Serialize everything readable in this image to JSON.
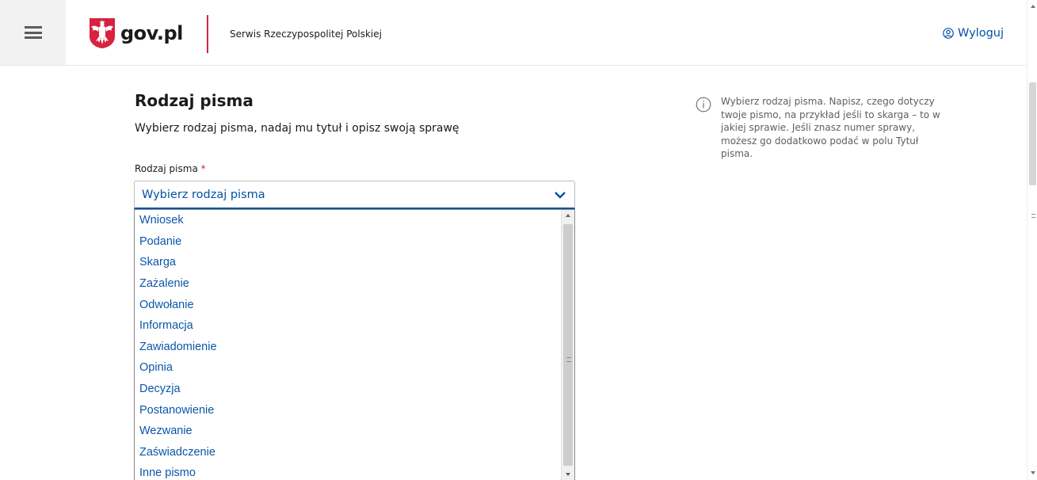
{
  "header": {
    "menu_icon": "hamburger-icon",
    "logo_emblem": "polish-eagle-emblem",
    "logo_text": "gov.pl",
    "service_name": "Serwis Rzeczypospolitej Polskiej",
    "logout_icon": "user-circle-icon",
    "logout_label": "Wyloguj"
  },
  "form": {
    "title": "Rodzaj pisma",
    "subtitle": "Wybierz rodzaj pisma, nadaj mu tytuł i opisz swoją sprawę",
    "field_label": "Rodzaj pisma",
    "required_mark": "*",
    "select_value": "Wybierz rodzaj pisma",
    "options": [
      "Wniosek",
      "Podanie",
      "Skarga",
      "Zażalenie",
      "Odwołanie",
      "Informacja",
      "Zawiadomienie",
      "Opinia",
      "Decyzja",
      "Postanowienie",
      "Wezwanie",
      "Zaświadczenie",
      "Inne pismo"
    ]
  },
  "help": {
    "icon": "info-icon",
    "text": "Wybierz rodzaj pisma. Napisz, czego dotyczy twoje pismo, na przykład jeśli to skarga – to w jakiej sprawie. Jeśli znasz numer sprawy, możesz go dodatkowo podać w polu Tytuł pisma."
  },
  "colors": {
    "accent": "#0052a5",
    "brand_red": "#d5233f"
  }
}
